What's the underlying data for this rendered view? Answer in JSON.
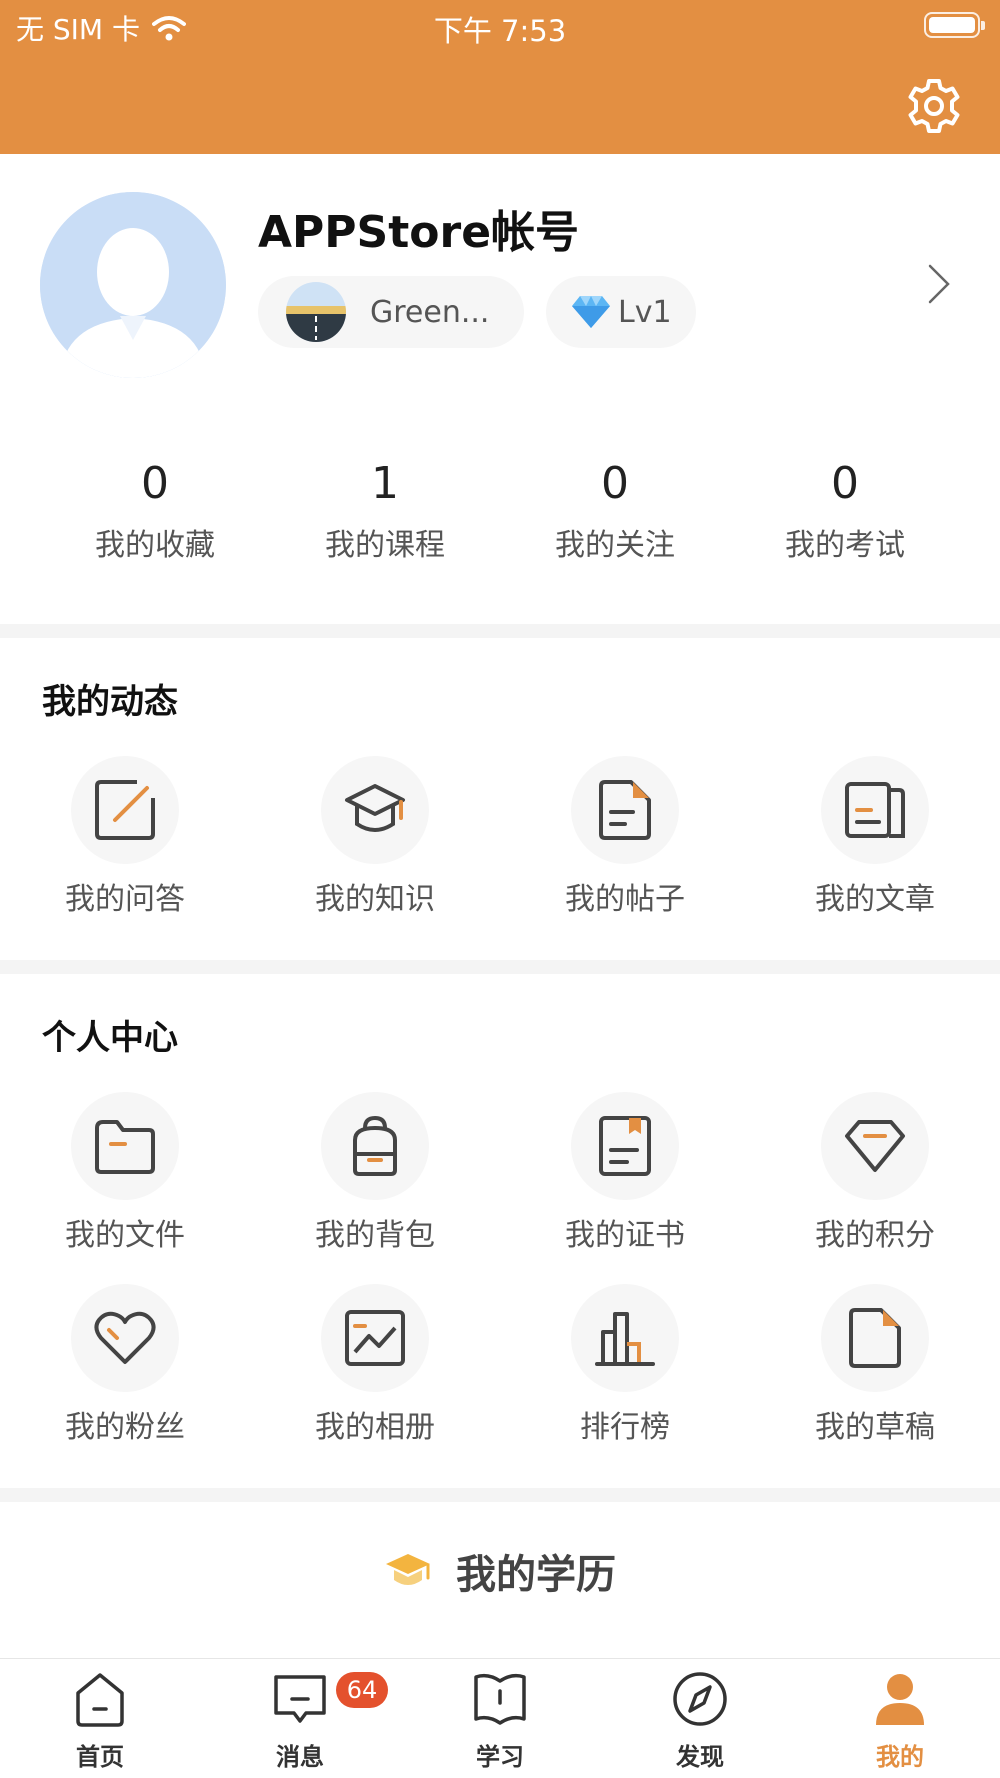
{
  "status_bar": {
    "carrier": "无 SIM 卡",
    "time": "下午 7:53",
    "battery_level": 1.0
  },
  "header": {
    "background_color": "#e38f42",
    "settings_icon": "gear-icon"
  },
  "profile": {
    "username": "APPStore帐号",
    "school": "Green...",
    "level": "Lv1",
    "level_icon": "diamond-icon"
  },
  "stats": [
    {
      "value": "0",
      "label": "我的收藏"
    },
    {
      "value": "1",
      "label": "我的课程"
    },
    {
      "value": "0",
      "label": "我的关注"
    },
    {
      "value": "0",
      "label": "我的考试"
    }
  ],
  "activity": {
    "title": "我的动态",
    "items": [
      {
        "label": "我的问答",
        "icon": "edit-icon"
      },
      {
        "label": "我的知识",
        "icon": "graduation-cap-icon"
      },
      {
        "label": "我的帖子",
        "icon": "document-icon"
      },
      {
        "label": "我的文章",
        "icon": "article-icon"
      }
    ]
  },
  "personal": {
    "title": "个人中心",
    "items": [
      {
        "label": "我的文件",
        "icon": "folder-icon"
      },
      {
        "label": "我的背包",
        "icon": "backpack-icon"
      },
      {
        "label": "我的证书",
        "icon": "certificate-icon"
      },
      {
        "label": "我的积分",
        "icon": "diamond-outline-icon"
      },
      {
        "label": "我的粉丝",
        "icon": "heart-icon"
      },
      {
        "label": "我的相册",
        "icon": "picture-icon"
      },
      {
        "label": "排行榜",
        "icon": "bar-chart-icon"
      },
      {
        "label": "我的草稿",
        "icon": "draft-icon"
      }
    ]
  },
  "education": {
    "title": "我的学历",
    "icon": "graduation-cap-icon"
  },
  "tabbar": {
    "active_color": "#e38f42",
    "badge_color": "#e4512d",
    "tabs": [
      {
        "label": "首页",
        "icon": "home-icon"
      },
      {
        "label": "消息",
        "icon": "message-icon",
        "badge": "64"
      },
      {
        "label": "学习",
        "icon": "book-icon"
      },
      {
        "label": "发现",
        "icon": "compass-icon"
      },
      {
        "label": "我的",
        "icon": "person-icon",
        "active": true
      }
    ]
  }
}
